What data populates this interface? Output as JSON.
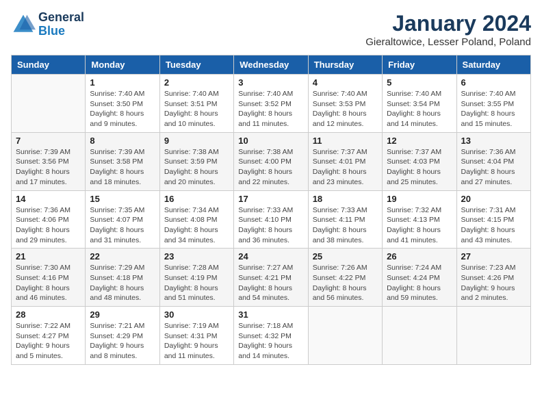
{
  "logo": {
    "general": "General",
    "blue": "Blue"
  },
  "title": "January 2024",
  "location": "Gieraltowice, Lesser Poland, Poland",
  "weekdays": [
    "Sunday",
    "Monday",
    "Tuesday",
    "Wednesday",
    "Thursday",
    "Friday",
    "Saturday"
  ],
  "weeks": [
    [
      {
        "day": "",
        "info": ""
      },
      {
        "day": "1",
        "info": "Sunrise: 7:40 AM\nSunset: 3:50 PM\nDaylight: 8 hours\nand 9 minutes."
      },
      {
        "day": "2",
        "info": "Sunrise: 7:40 AM\nSunset: 3:51 PM\nDaylight: 8 hours\nand 10 minutes."
      },
      {
        "day": "3",
        "info": "Sunrise: 7:40 AM\nSunset: 3:52 PM\nDaylight: 8 hours\nand 11 minutes."
      },
      {
        "day": "4",
        "info": "Sunrise: 7:40 AM\nSunset: 3:53 PM\nDaylight: 8 hours\nand 12 minutes."
      },
      {
        "day": "5",
        "info": "Sunrise: 7:40 AM\nSunset: 3:54 PM\nDaylight: 8 hours\nand 14 minutes."
      },
      {
        "day": "6",
        "info": "Sunrise: 7:40 AM\nSunset: 3:55 PM\nDaylight: 8 hours\nand 15 minutes."
      }
    ],
    [
      {
        "day": "7",
        "info": "Sunrise: 7:39 AM\nSunset: 3:56 PM\nDaylight: 8 hours\nand 17 minutes."
      },
      {
        "day": "8",
        "info": "Sunrise: 7:39 AM\nSunset: 3:58 PM\nDaylight: 8 hours\nand 18 minutes."
      },
      {
        "day": "9",
        "info": "Sunrise: 7:38 AM\nSunset: 3:59 PM\nDaylight: 8 hours\nand 20 minutes."
      },
      {
        "day": "10",
        "info": "Sunrise: 7:38 AM\nSunset: 4:00 PM\nDaylight: 8 hours\nand 22 minutes."
      },
      {
        "day": "11",
        "info": "Sunrise: 7:37 AM\nSunset: 4:01 PM\nDaylight: 8 hours\nand 23 minutes."
      },
      {
        "day": "12",
        "info": "Sunrise: 7:37 AM\nSunset: 4:03 PM\nDaylight: 8 hours\nand 25 minutes."
      },
      {
        "day": "13",
        "info": "Sunrise: 7:36 AM\nSunset: 4:04 PM\nDaylight: 8 hours\nand 27 minutes."
      }
    ],
    [
      {
        "day": "14",
        "info": "Sunrise: 7:36 AM\nSunset: 4:06 PM\nDaylight: 8 hours\nand 29 minutes."
      },
      {
        "day": "15",
        "info": "Sunrise: 7:35 AM\nSunset: 4:07 PM\nDaylight: 8 hours\nand 31 minutes."
      },
      {
        "day": "16",
        "info": "Sunrise: 7:34 AM\nSunset: 4:08 PM\nDaylight: 8 hours\nand 34 minutes."
      },
      {
        "day": "17",
        "info": "Sunrise: 7:33 AM\nSunset: 4:10 PM\nDaylight: 8 hours\nand 36 minutes."
      },
      {
        "day": "18",
        "info": "Sunrise: 7:33 AM\nSunset: 4:11 PM\nDaylight: 8 hours\nand 38 minutes."
      },
      {
        "day": "19",
        "info": "Sunrise: 7:32 AM\nSunset: 4:13 PM\nDaylight: 8 hours\nand 41 minutes."
      },
      {
        "day": "20",
        "info": "Sunrise: 7:31 AM\nSunset: 4:15 PM\nDaylight: 8 hours\nand 43 minutes."
      }
    ],
    [
      {
        "day": "21",
        "info": "Sunrise: 7:30 AM\nSunset: 4:16 PM\nDaylight: 8 hours\nand 46 minutes."
      },
      {
        "day": "22",
        "info": "Sunrise: 7:29 AM\nSunset: 4:18 PM\nDaylight: 8 hours\nand 48 minutes."
      },
      {
        "day": "23",
        "info": "Sunrise: 7:28 AM\nSunset: 4:19 PM\nDaylight: 8 hours\nand 51 minutes."
      },
      {
        "day": "24",
        "info": "Sunrise: 7:27 AM\nSunset: 4:21 PM\nDaylight: 8 hours\nand 54 minutes."
      },
      {
        "day": "25",
        "info": "Sunrise: 7:26 AM\nSunset: 4:22 PM\nDaylight: 8 hours\nand 56 minutes."
      },
      {
        "day": "26",
        "info": "Sunrise: 7:24 AM\nSunset: 4:24 PM\nDaylight: 8 hours\nand 59 minutes."
      },
      {
        "day": "27",
        "info": "Sunrise: 7:23 AM\nSunset: 4:26 PM\nDaylight: 9 hours\nand 2 minutes."
      }
    ],
    [
      {
        "day": "28",
        "info": "Sunrise: 7:22 AM\nSunset: 4:27 PM\nDaylight: 9 hours\nand 5 minutes."
      },
      {
        "day": "29",
        "info": "Sunrise: 7:21 AM\nSunset: 4:29 PM\nDaylight: 9 hours\nand 8 minutes."
      },
      {
        "day": "30",
        "info": "Sunrise: 7:19 AM\nSunset: 4:31 PM\nDaylight: 9 hours\nand 11 minutes."
      },
      {
        "day": "31",
        "info": "Sunrise: 7:18 AM\nSunset: 4:32 PM\nDaylight: 9 hours\nand 14 minutes."
      },
      {
        "day": "",
        "info": ""
      },
      {
        "day": "",
        "info": ""
      },
      {
        "day": "",
        "info": ""
      }
    ]
  ]
}
